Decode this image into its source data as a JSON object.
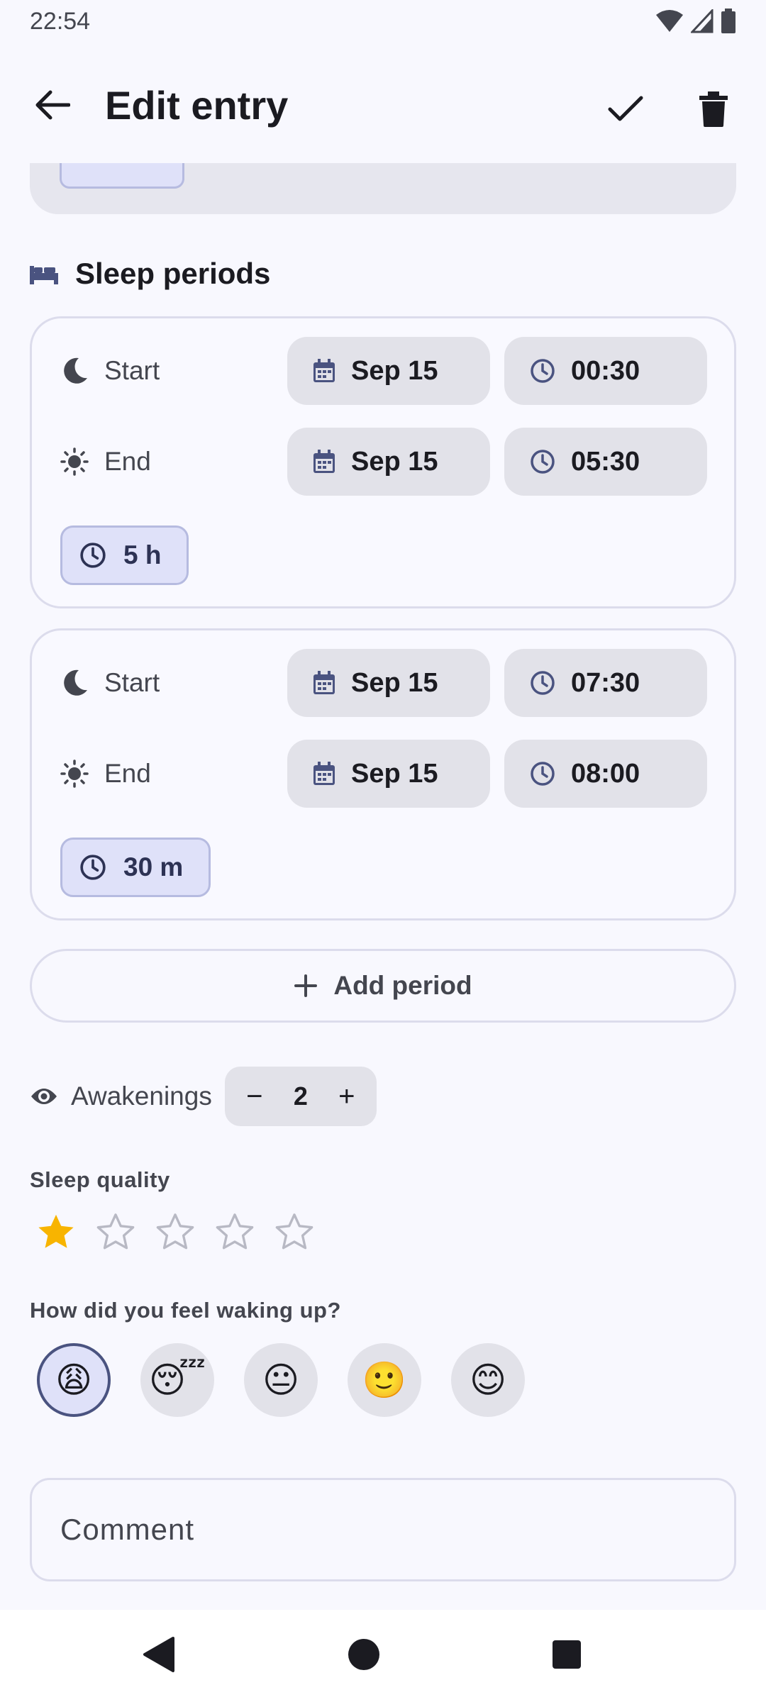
{
  "status": {
    "time": "22:54"
  },
  "appbar": {
    "title": "Edit entry"
  },
  "sleep_periods": {
    "title": "Sleep periods",
    "periods": [
      {
        "start_label": "Start",
        "start_date": "Sep 15",
        "start_time": "00:30",
        "end_label": "End",
        "end_date": "Sep 15",
        "end_time": "05:30",
        "duration": "5 h"
      },
      {
        "start_label": "Start",
        "start_date": "Sep 15",
        "start_time": "07:30",
        "end_label": "End",
        "end_date": "Sep 15",
        "end_time": "08:00",
        "duration": "30 m"
      }
    ],
    "add_label": "Add period"
  },
  "awakenings": {
    "label": "Awakenings",
    "value": "2",
    "minus": "−",
    "plus": "+"
  },
  "quality": {
    "label": "Sleep quality",
    "rating": 1,
    "max": 5
  },
  "mood": {
    "label": "How did you feel waking up?",
    "options": [
      "😩",
      "😴",
      "😐",
      "🙂",
      "😊"
    ],
    "selected_index": 0
  },
  "comment": {
    "placeholder": "Comment"
  },
  "colors": {
    "star_active": "#f8b400",
    "star_inactive": "#b8b9c4",
    "accent": "#4a5380"
  }
}
